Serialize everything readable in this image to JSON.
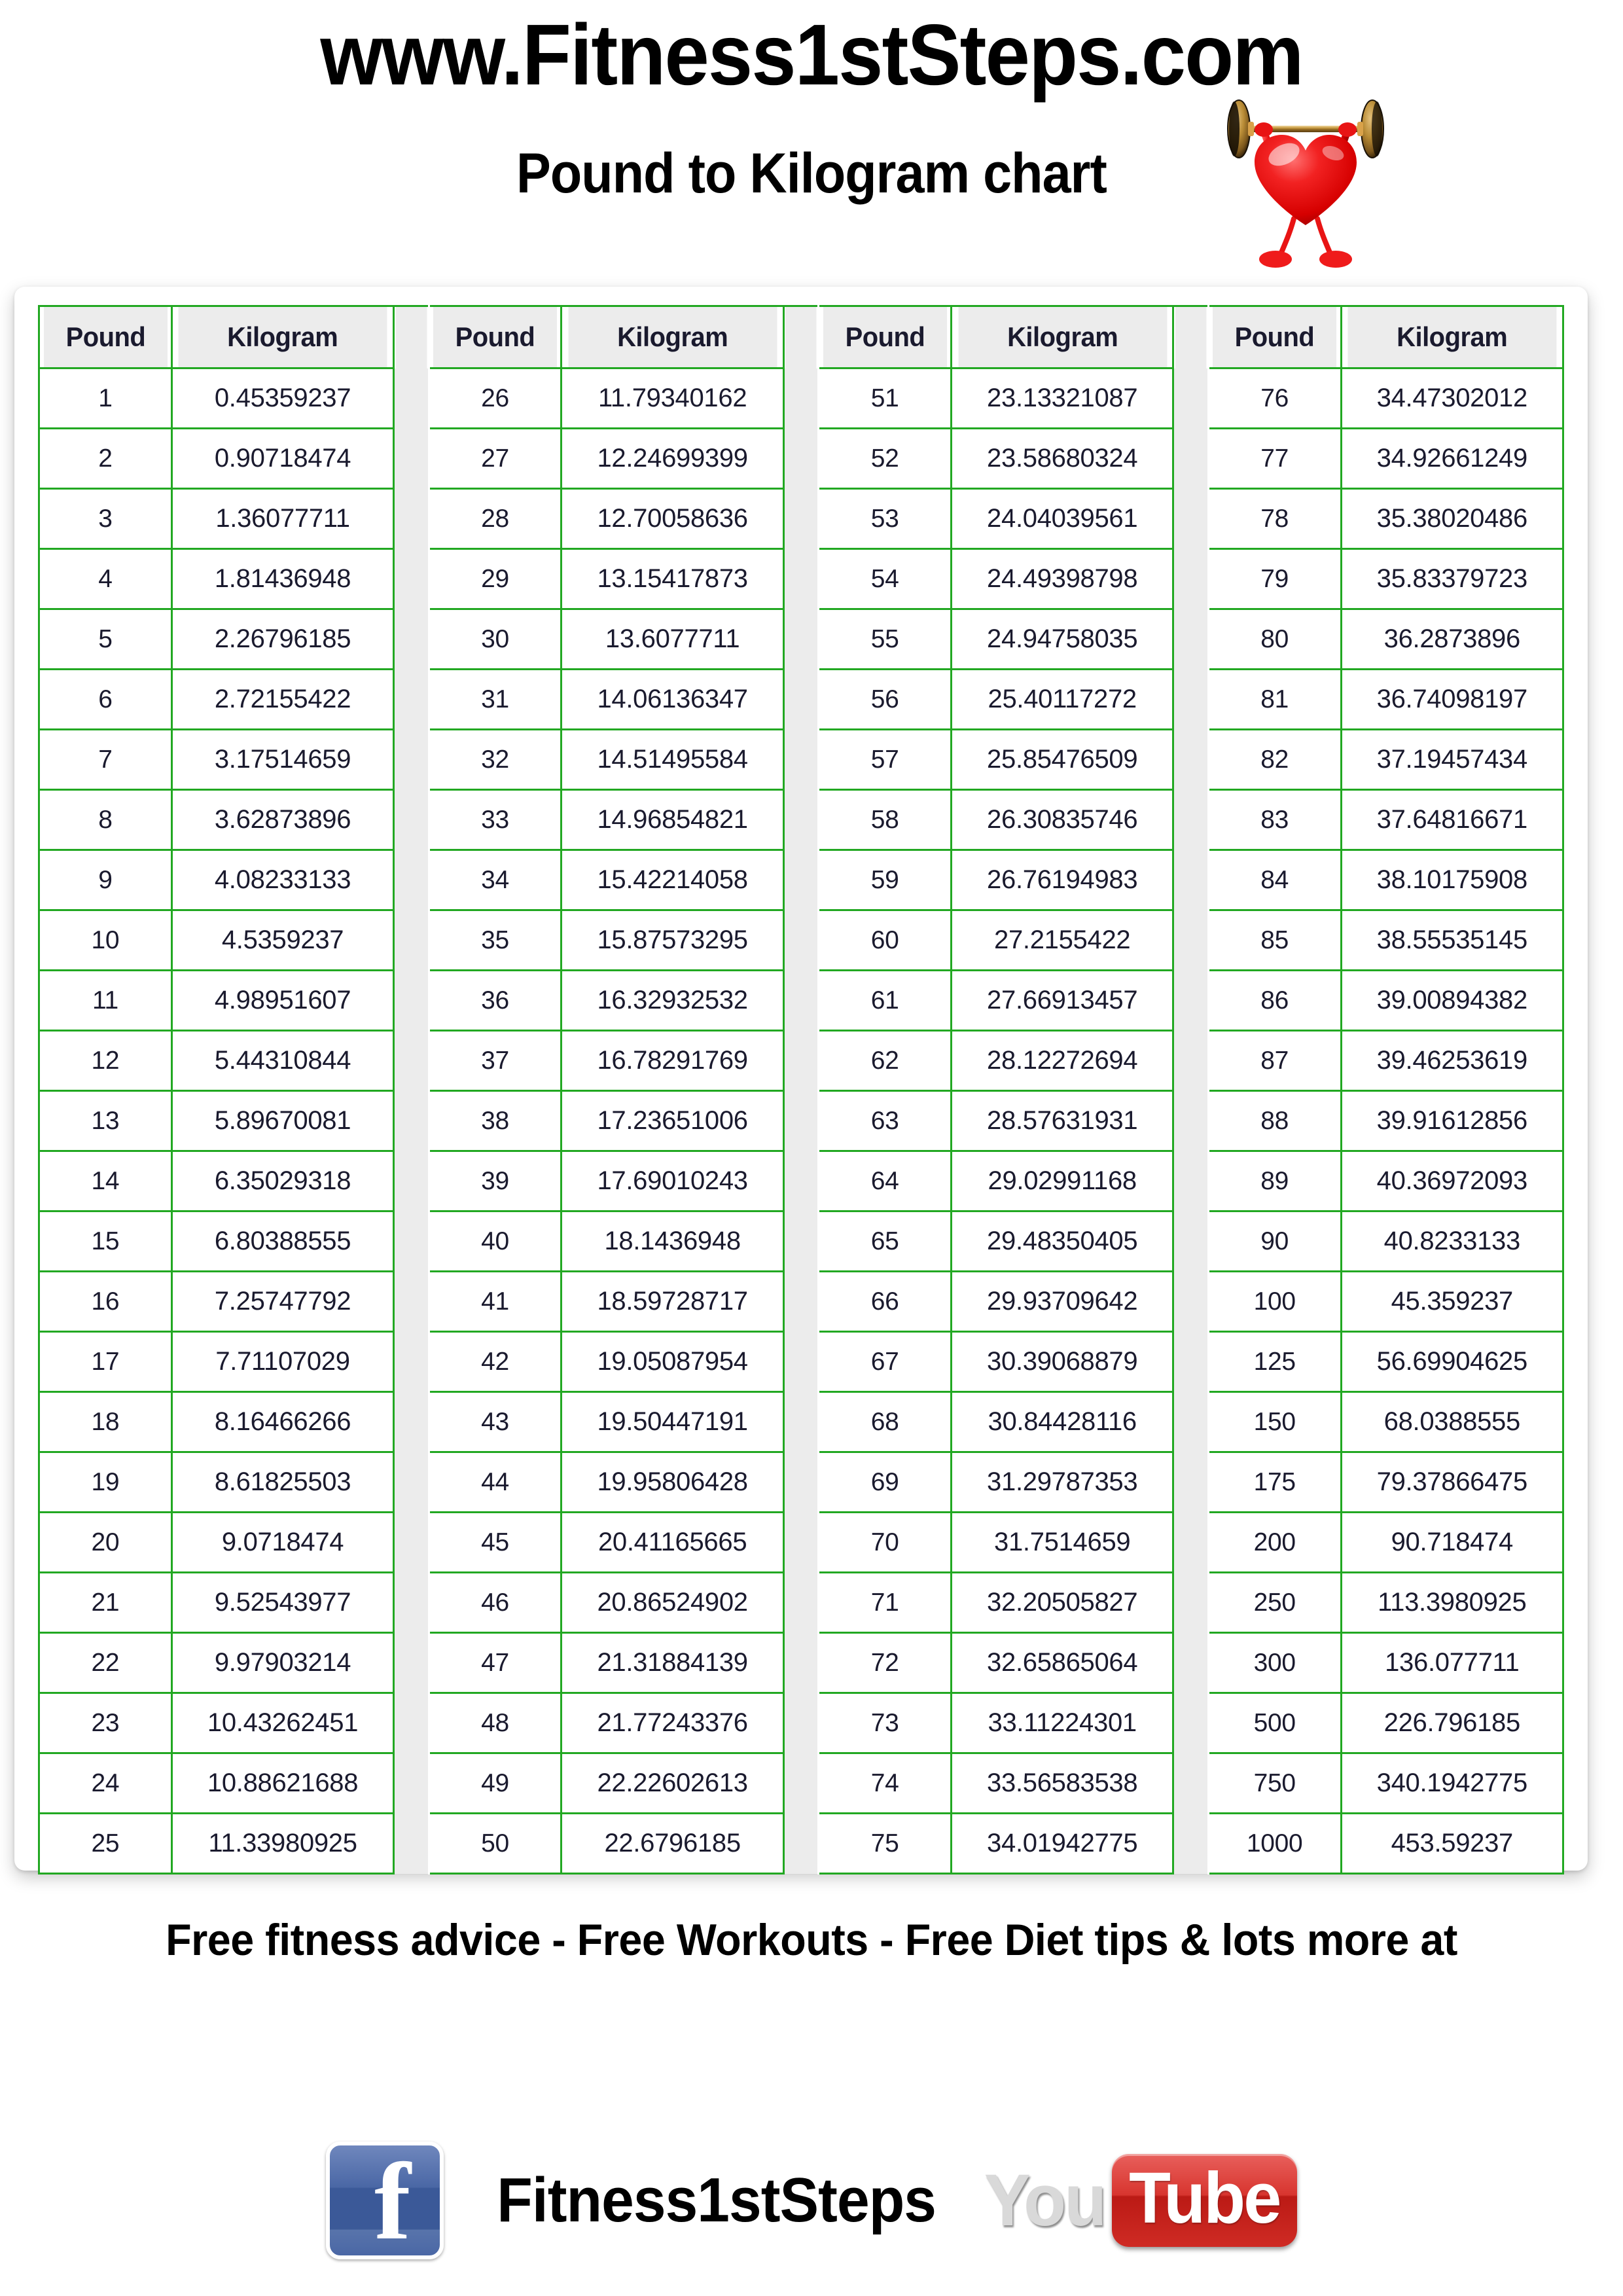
{
  "header": {
    "site_url": "www.Fitness1stSteps.com",
    "chart_title": "Pound to Kilogram chart",
    "mascot": "heart-lifting-barbell"
  },
  "table": {
    "headers": [
      "Pound",
      "Kilogram"
    ],
    "groups": [
      {
        "rows": [
          {
            "lb": "1",
            "kg": "0.45359237"
          },
          {
            "lb": "2",
            "kg": "0.90718474"
          },
          {
            "lb": "3",
            "kg": "1.36077711"
          },
          {
            "lb": "4",
            "kg": "1.81436948"
          },
          {
            "lb": "5",
            "kg": "2.26796185"
          },
          {
            "lb": "6",
            "kg": "2.72155422"
          },
          {
            "lb": "7",
            "kg": "3.17514659"
          },
          {
            "lb": "8",
            "kg": "3.62873896"
          },
          {
            "lb": "9",
            "kg": "4.08233133"
          },
          {
            "lb": "10",
            "kg": "4.5359237"
          },
          {
            "lb": "11",
            "kg": "4.98951607"
          },
          {
            "lb": "12",
            "kg": "5.44310844"
          },
          {
            "lb": "13",
            "kg": "5.89670081"
          },
          {
            "lb": "14",
            "kg": "6.35029318"
          },
          {
            "lb": "15",
            "kg": "6.80388555"
          },
          {
            "lb": "16",
            "kg": "7.25747792"
          },
          {
            "lb": "17",
            "kg": "7.71107029"
          },
          {
            "lb": "18",
            "kg": "8.16466266"
          },
          {
            "lb": "19",
            "kg": "8.61825503"
          },
          {
            "lb": "20",
            "kg": "9.0718474"
          },
          {
            "lb": "21",
            "kg": "9.52543977"
          },
          {
            "lb": "22",
            "kg": "9.97903214"
          },
          {
            "lb": "23",
            "kg": "10.43262451"
          },
          {
            "lb": "24",
            "kg": "10.88621688"
          },
          {
            "lb": "25",
            "kg": "11.33980925"
          }
        ]
      },
      {
        "rows": [
          {
            "lb": "26",
            "kg": "11.79340162"
          },
          {
            "lb": "27",
            "kg": "12.24699399"
          },
          {
            "lb": "28",
            "kg": "12.70058636"
          },
          {
            "lb": "29",
            "kg": "13.15417873"
          },
          {
            "lb": "30",
            "kg": "13.6077711"
          },
          {
            "lb": "31",
            "kg": "14.06136347"
          },
          {
            "lb": "32",
            "kg": "14.51495584"
          },
          {
            "lb": "33",
            "kg": "14.96854821"
          },
          {
            "lb": "34",
            "kg": "15.42214058"
          },
          {
            "lb": "35",
            "kg": "15.87573295"
          },
          {
            "lb": "36",
            "kg": "16.32932532"
          },
          {
            "lb": "37",
            "kg": "16.78291769"
          },
          {
            "lb": "38",
            "kg": "17.23651006"
          },
          {
            "lb": "39",
            "kg": "17.69010243"
          },
          {
            "lb": "40",
            "kg": "18.1436948"
          },
          {
            "lb": "41",
            "kg": "18.59728717"
          },
          {
            "lb": "42",
            "kg": "19.05087954"
          },
          {
            "lb": "43",
            "kg": "19.50447191"
          },
          {
            "lb": "44",
            "kg": "19.95806428"
          },
          {
            "lb": "45",
            "kg": "20.41165665"
          },
          {
            "lb": "46",
            "kg": "20.86524902"
          },
          {
            "lb": "47",
            "kg": "21.31884139"
          },
          {
            "lb": "48",
            "kg": "21.77243376"
          },
          {
            "lb": "49",
            "kg": "22.22602613"
          },
          {
            "lb": "50",
            "kg": "22.6796185"
          }
        ]
      },
      {
        "rows": [
          {
            "lb": "51",
            "kg": "23.13321087"
          },
          {
            "lb": "52",
            "kg": "23.58680324"
          },
          {
            "lb": "53",
            "kg": "24.04039561"
          },
          {
            "lb": "54",
            "kg": "24.49398798"
          },
          {
            "lb": "55",
            "kg": "24.94758035"
          },
          {
            "lb": "56",
            "kg": "25.40117272"
          },
          {
            "lb": "57",
            "kg": "25.85476509"
          },
          {
            "lb": "58",
            "kg": "26.30835746"
          },
          {
            "lb": "59",
            "kg": "26.76194983"
          },
          {
            "lb": "60",
            "kg": "27.2155422"
          },
          {
            "lb": "61",
            "kg": "27.66913457"
          },
          {
            "lb": "62",
            "kg": "28.12272694"
          },
          {
            "lb": "63",
            "kg": "28.57631931"
          },
          {
            "lb": "64",
            "kg": "29.02991168"
          },
          {
            "lb": "65",
            "kg": "29.48350405"
          },
          {
            "lb": "66",
            "kg": "29.93709642"
          },
          {
            "lb": "67",
            "kg": "30.39068879"
          },
          {
            "lb": "68",
            "kg": "30.84428116"
          },
          {
            "lb": "69",
            "kg": "31.29787353"
          },
          {
            "lb": "70",
            "kg": "31.7514659"
          },
          {
            "lb": "71",
            "kg": "32.20505827"
          },
          {
            "lb": "72",
            "kg": "32.65865064"
          },
          {
            "lb": "73",
            "kg": "33.11224301"
          },
          {
            "lb": "74",
            "kg": "33.56583538"
          },
          {
            "lb": "75",
            "kg": "34.01942775"
          }
        ]
      },
      {
        "rows": [
          {
            "lb": "76",
            "kg": "34.47302012"
          },
          {
            "lb": "77",
            "kg": "34.92661249"
          },
          {
            "lb": "78",
            "kg": "35.38020486"
          },
          {
            "lb": "79",
            "kg": "35.83379723"
          },
          {
            "lb": "80",
            "kg": "36.2873896"
          },
          {
            "lb": "81",
            "kg": "36.74098197"
          },
          {
            "lb": "82",
            "kg": "37.19457434"
          },
          {
            "lb": "83",
            "kg": "37.64816671"
          },
          {
            "lb": "84",
            "kg": "38.10175908"
          },
          {
            "lb": "85",
            "kg": "38.55535145"
          },
          {
            "lb": "86",
            "kg": "39.00894382"
          },
          {
            "lb": "87",
            "kg": "39.46253619"
          },
          {
            "lb": "88",
            "kg": "39.91612856"
          },
          {
            "lb": "89",
            "kg": "40.36972093"
          },
          {
            "lb": "90",
            "kg": "40.8233133"
          },
          {
            "lb": "100",
            "kg": "45.359237"
          },
          {
            "lb": "125",
            "kg": "56.69904625"
          },
          {
            "lb": "150",
            "kg": "68.0388555"
          },
          {
            "lb": "175",
            "kg": "79.37866475"
          },
          {
            "lb": "200",
            "kg": "90.718474"
          },
          {
            "lb": "250",
            "kg": "113.3980925"
          },
          {
            "lb": "300",
            "kg": "136.077711"
          },
          {
            "lb": "500",
            "kg": "226.796185"
          },
          {
            "lb": "750",
            "kg": "340.1942775"
          },
          {
            "lb": "1000",
            "kg": "453.59237"
          }
        ]
      }
    ]
  },
  "footer": {
    "tagline": "Free fitness advice - Free Workouts - Free Diet tips & lots more at",
    "facebook_icon": "facebook-icon",
    "brand_name": "Fitness1stSteps",
    "youtube_you": "You",
    "youtube_tube": "Tube"
  },
  "colors": {
    "table_border_green": "#22a822",
    "header_fill": "#ececec",
    "facebook_blue": "#3b5998",
    "youtube_red": "#cf2b24",
    "heart_red": "#ee1c1c"
  }
}
